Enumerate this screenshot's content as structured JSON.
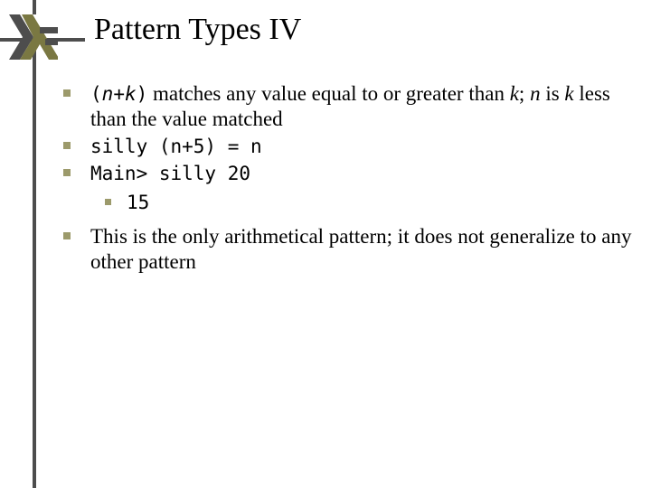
{
  "title": "Pattern Types IV",
  "bullet1": {
    "nk_open": "(",
    "n": "n",
    "plus": "+",
    "k": "k",
    "nk_close": ")",
    "t1": " matches any value equal to or greater than ",
    "k2": "k",
    "t2": "; ",
    "n2": "n",
    "t3": " is ",
    "k3": "k",
    "t4": " less than the value matched"
  },
  "bullet2": "silly (n+5) = n",
  "bullet3": "Main> silly 20",
  "sub1": "15",
  "bullet4": "This is the only arithmetical pattern; it does not generalize to any other pattern"
}
